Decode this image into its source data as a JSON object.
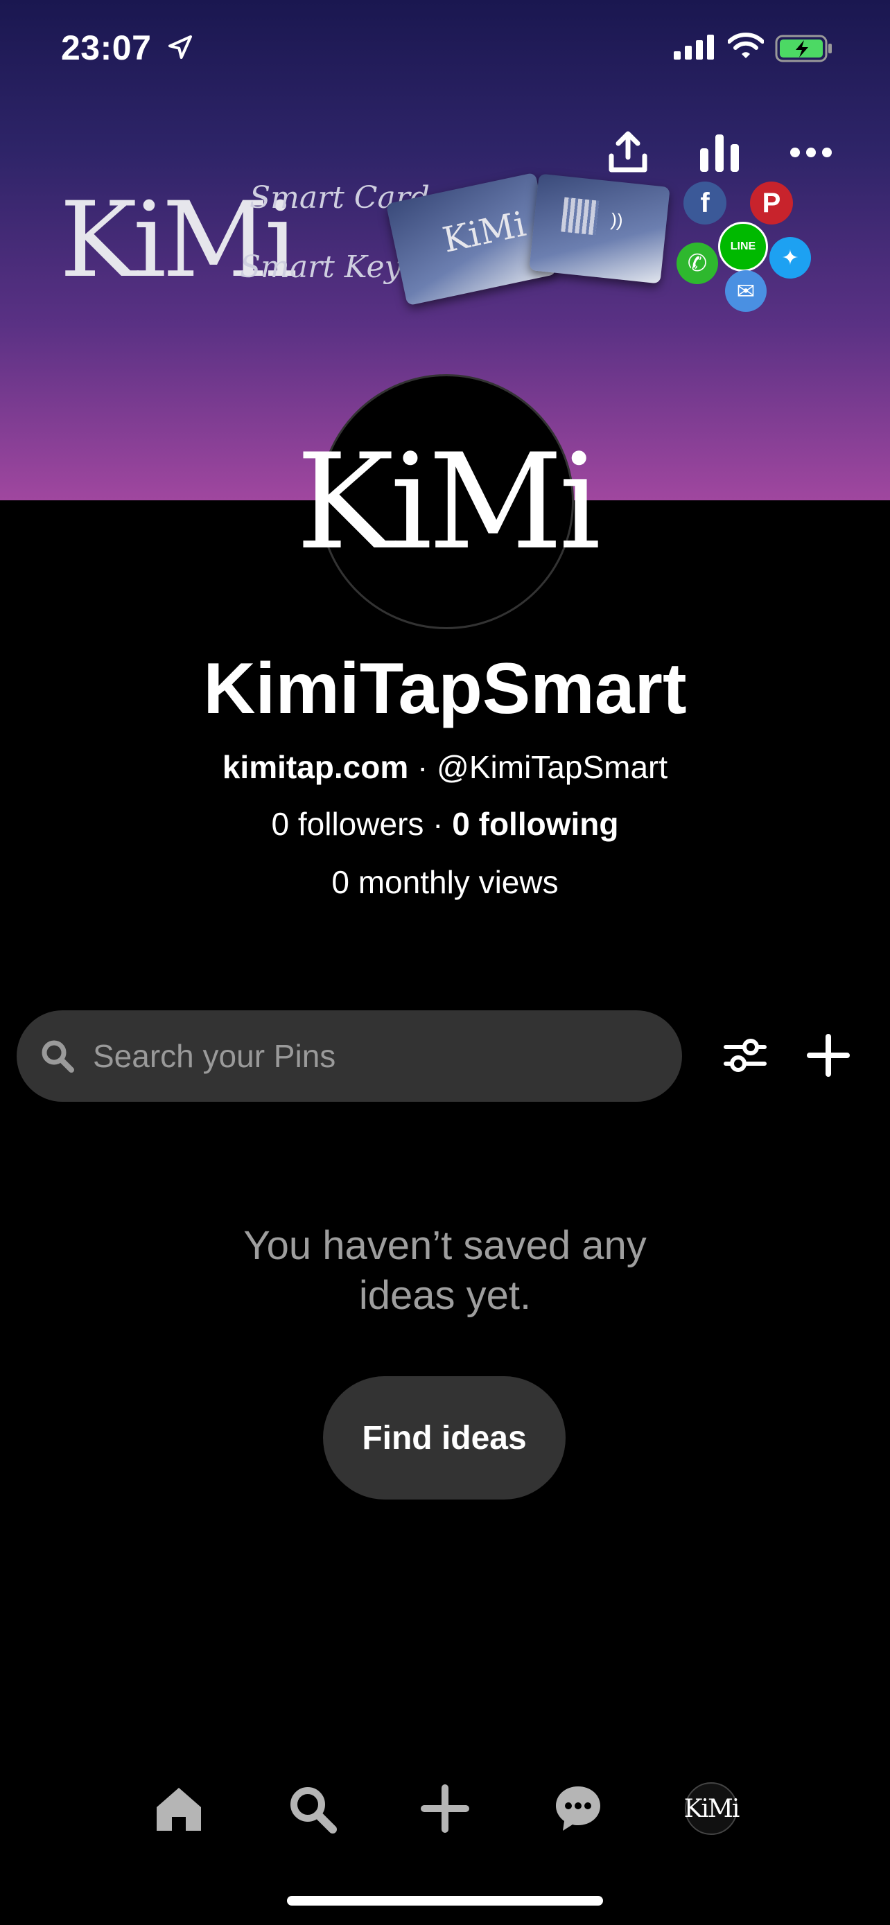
{
  "status_bar": {
    "time": "23:07"
  },
  "banner": {
    "logo": "KiMi",
    "tagline_1": "Smart Card",
    "tagline_2": "Smart Keychain",
    "card_logo": "KiMi",
    "social_line_badge": "LINE"
  },
  "profile": {
    "avatar_text": "KiMi",
    "name": "KimiTapSmart",
    "website": "kimitap.com",
    "separator": " · ",
    "handle": "@KimiTapSmart",
    "followers": "0 followers",
    "following": "0 following",
    "monthly_views": "0 monthly views"
  },
  "search": {
    "placeholder": "Search your Pins"
  },
  "empty_state": {
    "message_line1": "You haven’t saved any",
    "message_line2": "ideas yet.",
    "button": "Find ideas"
  },
  "tabbar": {
    "profile_avatar_text": "KiMi"
  },
  "colors": {
    "background": "#000000",
    "surface": "#333333",
    "muted_text": "#9e9e9e",
    "battery": "#4cd964"
  }
}
